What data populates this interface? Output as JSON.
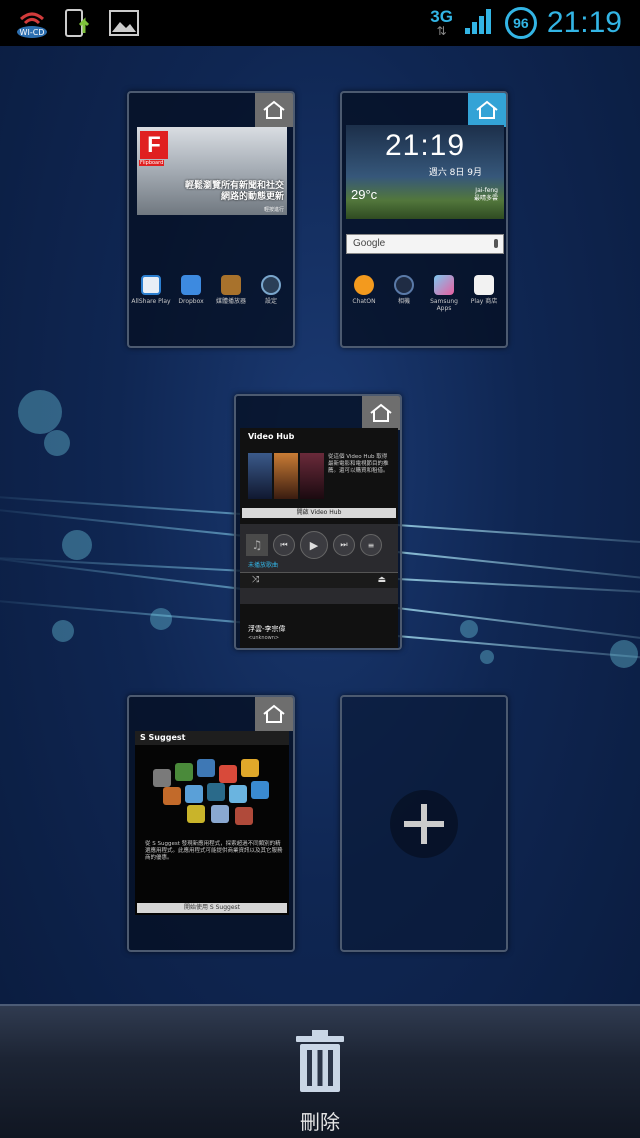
{
  "status_bar": {
    "network_type": "3G",
    "battery_level": "96",
    "time": "21:19",
    "icons": [
      "wifi-cd-icon",
      "phone-upload-icon",
      "image-icon",
      "signal-icon"
    ],
    "accent_color": "#33b5e5"
  },
  "pages": {
    "page1": {
      "flipboard_logo": "F",
      "flipboard_brand": "Flipboard",
      "flipboard_headline": "輕鬆瀏覽所有新聞和社交網路的動態更新",
      "flipboard_sub": "輕按進行",
      "apps": [
        "AllShare Play",
        "Dropbox",
        "媒體播放器",
        "設定"
      ]
    },
    "page2": {
      "clock_time": "21:19",
      "clock_date": "週六 8日 9月",
      "temperature": "29°c",
      "location": "Jai-feng\n最晴多雲",
      "search_label": "Google",
      "apps": [
        "ChatON",
        "相機",
        "Samsung Apps",
        "Play 商店"
      ]
    },
    "page3": {
      "videohub_title": "Video Hub",
      "videohub_desc": "從這個 Video Hub 取得最新電影和電視節目的推薦。還可以購買和租借。",
      "videohub_button": "開啟 Video Hub",
      "player_status": "未播放歌曲",
      "song_title": "浮雲-李宗偉",
      "artist": "<unknown>"
    },
    "page4": {
      "ssuggest_title": "S Suggest",
      "ssuggest_desc": "從 S Suggest 發現新應用程式，探索超過不同類別的精選應用程式。此應用程式可能提供商業資訊以及其它服務商的優惠。",
      "ssuggest_button": "開始使用 S Suggest"
    },
    "add_page": {
      "symbol": "+"
    }
  },
  "bottom_bar": {
    "delete_label": "刪除"
  }
}
